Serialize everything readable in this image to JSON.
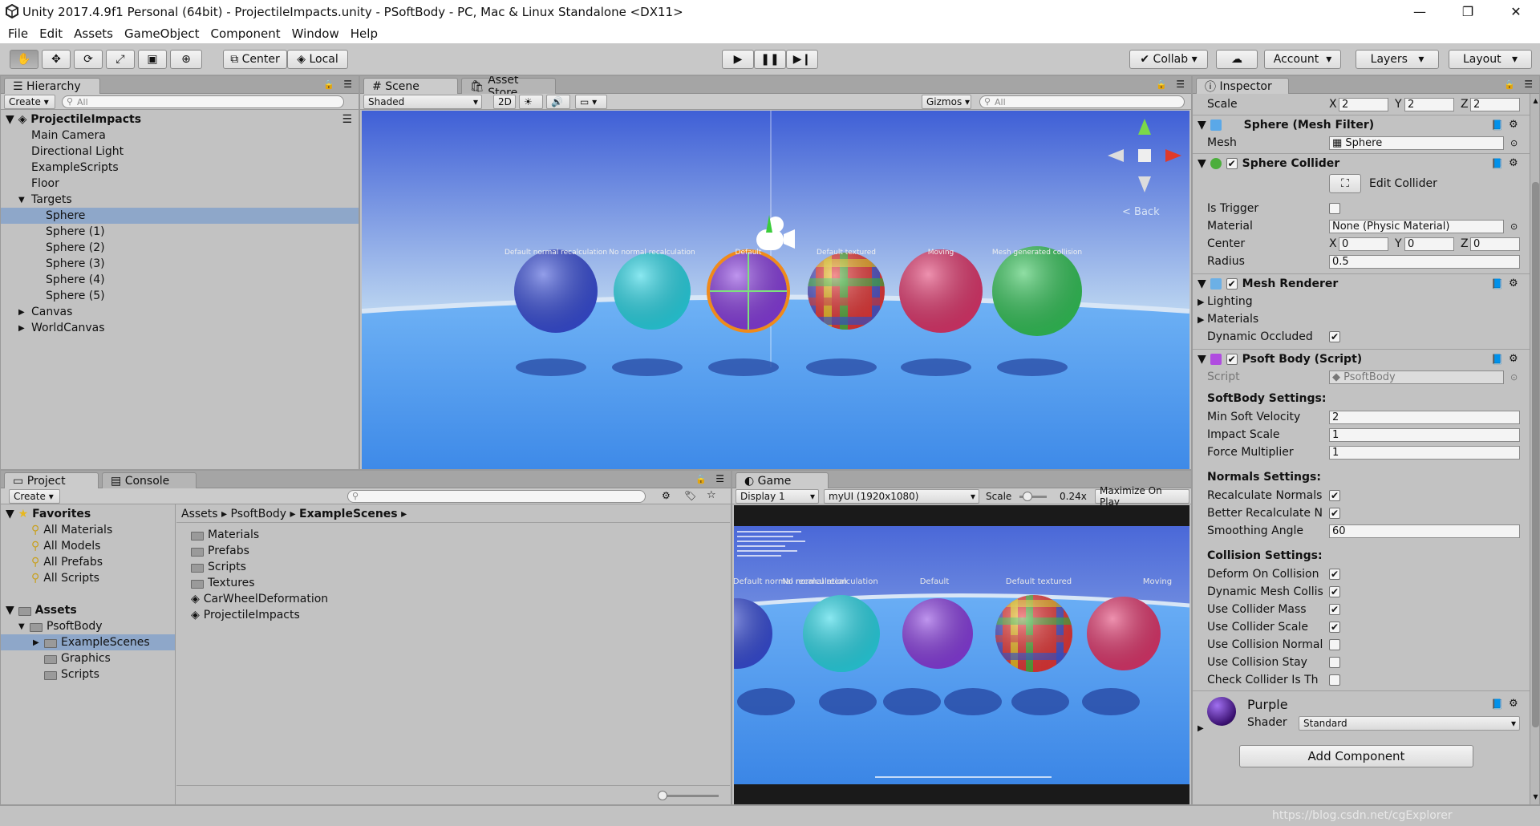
{
  "window": {
    "title": "Unity 2017.4.9f1 Personal (64bit) - ProjectileImpacts.unity - PSoftBody - PC, Mac & Linux Standalone <DX11>",
    "minimize": "—",
    "restore": "❐",
    "close": "✕"
  },
  "menu": [
    "File",
    "Edit",
    "Assets",
    "GameObject",
    "Component",
    "Window",
    "Help"
  ],
  "toolbar": {
    "pivot": "Center",
    "space": "Local",
    "collab": "Collab",
    "account": "Account",
    "layers": "Layers",
    "layout": "Layout"
  },
  "hierarchy": {
    "tab": "Hierarchy",
    "create": "Create",
    "search_placeholder": "All",
    "scene": "ProjectileImpacts",
    "items": [
      {
        "label": "Main Camera",
        "depth": 1
      },
      {
        "label": "Directional Light",
        "depth": 1
      },
      {
        "label": "ExampleScripts",
        "depth": 1
      },
      {
        "label": "Floor",
        "depth": 1
      },
      {
        "label": "Targets",
        "depth": 1,
        "expanded": true
      },
      {
        "label": "Sphere",
        "depth": 2,
        "selected": true
      },
      {
        "label": "Sphere (1)",
        "depth": 2
      },
      {
        "label": "Sphere (2)",
        "depth": 2
      },
      {
        "label": "Sphere (3)",
        "depth": 2
      },
      {
        "label": "Sphere (4)",
        "depth": 2
      },
      {
        "label": "Sphere (5)",
        "depth": 2
      },
      {
        "label": "Canvas",
        "depth": 1,
        "collapsed": true
      },
      {
        "label": "WorldCanvas",
        "depth": 1,
        "collapsed": true
      }
    ]
  },
  "scene": {
    "tab": "Scene",
    "tab2": "Asset Store",
    "shading": "Shaded",
    "mode2d": "2D",
    "gizmos": "Gizmos",
    "search_placeholder": "All",
    "back": "Back",
    "labels": [
      "Default normal recalculation",
      "No normal recalculation",
      "Default",
      "Default textured",
      "Moving",
      "Mesh generated collision"
    ],
    "spheres": [
      {
        "color": "#3a4fd8"
      },
      {
        "color": "#2bd6e6"
      },
      {
        "color": "#8a3fe0"
      },
      {
        "color": "#e84040"
      },
      {
        "color": "#e0386e"
      },
      {
        "color": "#35c45a"
      }
    ]
  },
  "project": {
    "tab": "Project",
    "tab2": "Console",
    "create": "Create",
    "favorites": "Favorites",
    "fav_items": [
      "All Materials",
      "All Models",
      "All Prefabs",
      "All Scripts"
    ],
    "assets": "Assets",
    "asset_tree": [
      {
        "label": "PsoftBody",
        "depth": 1
      },
      {
        "label": "ExampleScenes",
        "depth": 2,
        "selected": true
      },
      {
        "label": "Graphics",
        "depth": 2
      },
      {
        "label": "Scripts",
        "depth": 2
      }
    ],
    "breadcrumb": [
      "Assets",
      "PsoftBody",
      "ExampleScenes"
    ],
    "files": [
      {
        "label": "Materials",
        "kind": "folder"
      },
      {
        "label": "Prefabs",
        "kind": "folder"
      },
      {
        "label": "Scripts",
        "kind": "folder"
      },
      {
        "label": "Textures",
        "kind": "folder"
      },
      {
        "label": "CarWheelDeformation",
        "kind": "scene"
      },
      {
        "label": "ProjectileImpacts",
        "kind": "scene"
      }
    ]
  },
  "game": {
    "tab": "Game",
    "display": "Display 1",
    "resolution": "myUI (1920x1080)",
    "scale_label": "Scale",
    "scale_value": "0.24x",
    "maximize": "Maximize On Play",
    "labels": [
      "Default normal recalculation",
      "No normal recalculation",
      "Default",
      "Default textured",
      "Moving"
    ]
  },
  "inspector": {
    "tab": "Inspector",
    "scale": {
      "label": "Scale",
      "x": "2",
      "y": "2",
      "z": "2"
    },
    "mesh_filter": {
      "title": "Sphere (Mesh Filter)",
      "mesh_label": "Mesh",
      "mesh_value": "Sphere"
    },
    "sphere_collider": {
      "title": "Sphere Collider",
      "edit": "Edit Collider",
      "is_trigger": "Is Trigger",
      "material_label": "Material",
      "material_value": "None (Physic Material)",
      "center_label": "Center",
      "cx": "0",
      "cy": "0",
      "cz": "0",
      "radius_label": "Radius",
      "radius_value": "0.5"
    },
    "mesh_renderer": {
      "title": "Mesh Renderer",
      "lighting": "Lighting",
      "materials": "Materials",
      "dynamic_occluded": "Dynamic Occluded"
    },
    "psoft": {
      "title": "Psoft Body (Script)",
      "script_label": "Script",
      "script_value": "PsoftBody",
      "softbody_header": "SoftBody Settings:",
      "min_soft_velocity": "Min Soft Velocity",
      "min_soft_velocity_value": "2",
      "impact_scale": "Impact Scale",
      "impact_scale_value": "1",
      "force_multiplier": "Force Multiplier",
      "force_multiplier_value": "1",
      "normals_header": "Normals Settings:",
      "recalculate_normals": "Recalculate Normals",
      "better_recalculate": "Better Recalculate N",
      "smoothing_angle": "Smoothing Angle",
      "smoothing_angle_value": "60",
      "collision_header": "Collision Settings:",
      "collision_items": [
        {
          "label": "Deform On Collision",
          "checked": true
        },
        {
          "label": "Dynamic Mesh Collis",
          "checked": true
        },
        {
          "label": "Use Collider Mass",
          "checked": true
        },
        {
          "label": "Use Collider Scale",
          "checked": true
        },
        {
          "label": "Use Collision Normal",
          "checked": false
        },
        {
          "label": "Use Collision Stay",
          "checked": false
        },
        {
          "label": "Check Collider Is Th",
          "checked": false
        }
      ]
    },
    "material": {
      "name": "Purple",
      "shader_label": "Shader",
      "shader_value": "Standard"
    },
    "add_component": "Add Component"
  },
  "watermark": "https://blog.csdn.net/cgExplorer",
  "colors": {
    "selection": "#8ea7c9",
    "sky_top": "#3f5fd6",
    "sky_bottom": "#bcd6f2",
    "floor": "#4f9ef0"
  }
}
